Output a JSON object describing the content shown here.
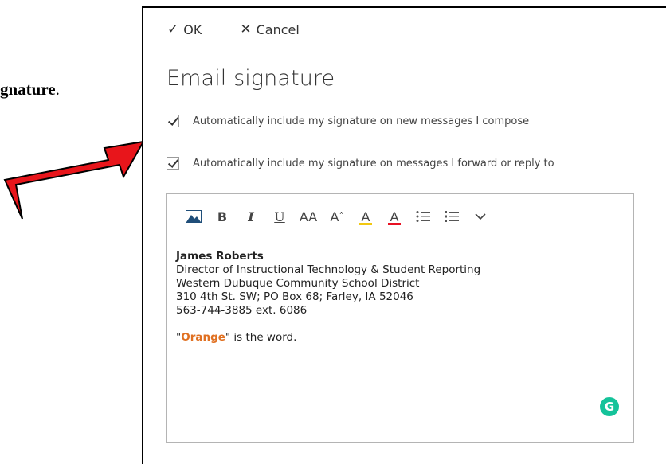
{
  "doc": {
    "text_bold": "gnature",
    "text_plain": "."
  },
  "commands": {
    "ok_label": "OK",
    "cancel_label": "Cancel"
  },
  "page_title": "Email signature",
  "options": {
    "new_messages": {
      "label": "Automatically include my signature on new messages I compose",
      "checked": true
    },
    "forward_reply": {
      "label": "Automatically include my signature on messages I forward or reply to",
      "checked": true
    }
  },
  "toolbar_icons": [
    "picture-icon",
    "bold-icon",
    "italic-icon",
    "underline-icon",
    "font-size-icon",
    "grow-font-icon",
    "highlight-icon",
    "font-color-icon",
    "bullets-icon",
    "numbering-icon",
    "more-options-icon"
  ],
  "toolbar_glyphs": {
    "bold": "B",
    "italic": "I",
    "underline": "U",
    "font_size": "AA",
    "grow_font": "A",
    "highlight": "A",
    "font_color": "A"
  },
  "signature": {
    "name": "James Roberts",
    "title": "Director of Instructional Technology & Student Reporting",
    "organization": "Western Dubuque Community School District",
    "address": "310 4th St. SW; PO Box 68; Farley, IA  52046",
    "phone": "563-744-3885  ext. 6086",
    "tagline_prefix": "\"",
    "tagline_highlight": "Orange",
    "tagline_suffix": "\" is the word."
  },
  "grammarly_badge": "G",
  "colors": {
    "highlight_bar": "#f2c811",
    "font_color_bar": "#e81123",
    "orange_text": "#e07021",
    "grammarly": "#15c39a",
    "arrow_fill": "#e8151b"
  }
}
